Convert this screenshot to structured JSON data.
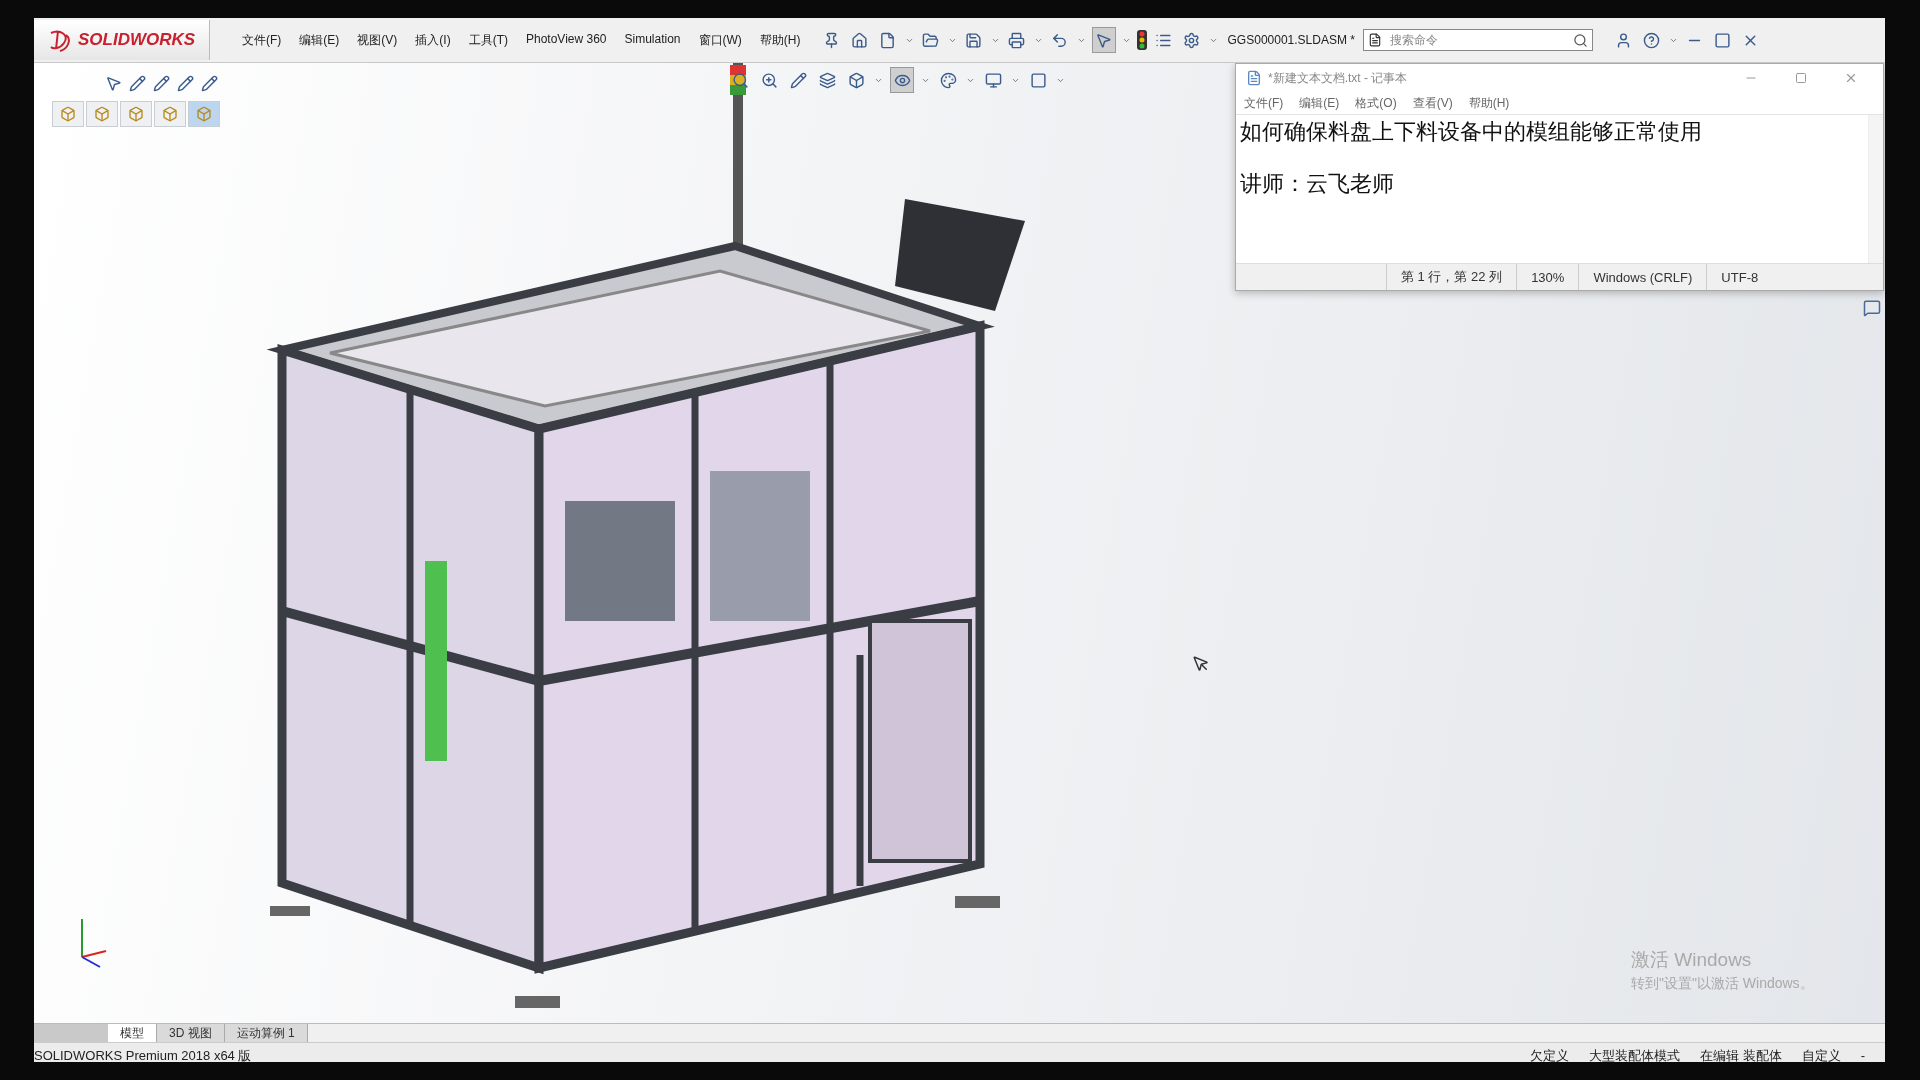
{
  "app": {
    "logo": "SOLIDWORKS",
    "menu": [
      "文件(F)",
      "编辑(E)",
      "视图(V)",
      "插入(I)",
      "工具(T)",
      "PhotoView 360",
      "Simulation",
      "窗口(W)",
      "帮助(H)"
    ],
    "document_title": "GGS000001.SLDASM *",
    "search": {
      "placeholder": "搜索命令"
    }
  },
  "notepad": {
    "title": "*新建文本文档.txt - 记事本",
    "menu": [
      "文件(F)",
      "编辑(E)",
      "格式(O)",
      "查看(V)",
      "帮助(H)"
    ],
    "paragraphs": [
      "如何确保料盘上下料设备中的模组能够正常使用",
      "讲师：云飞老师"
    ],
    "status": [
      "第 1 行，第 22 列",
      "130%",
      "Windows (CRLF)",
      "UTF-8"
    ]
  },
  "tabs": [
    {
      "label": "模型",
      "selected": true
    },
    {
      "label": "3D 视图",
      "selected": false
    },
    {
      "label": "运动算例 1",
      "selected": false
    }
  ],
  "status_bar": {
    "product": "SOLIDWORKS Premium 2018 x64 版",
    "items": [
      "欠定义",
      "大型装配体模式",
      "在编辑 装配体",
      "自定义",
      "-"
    ]
  },
  "activation": {
    "title": "激活 Windows",
    "subtitle": "转到\"设置\"以激活 Windows。"
  }
}
